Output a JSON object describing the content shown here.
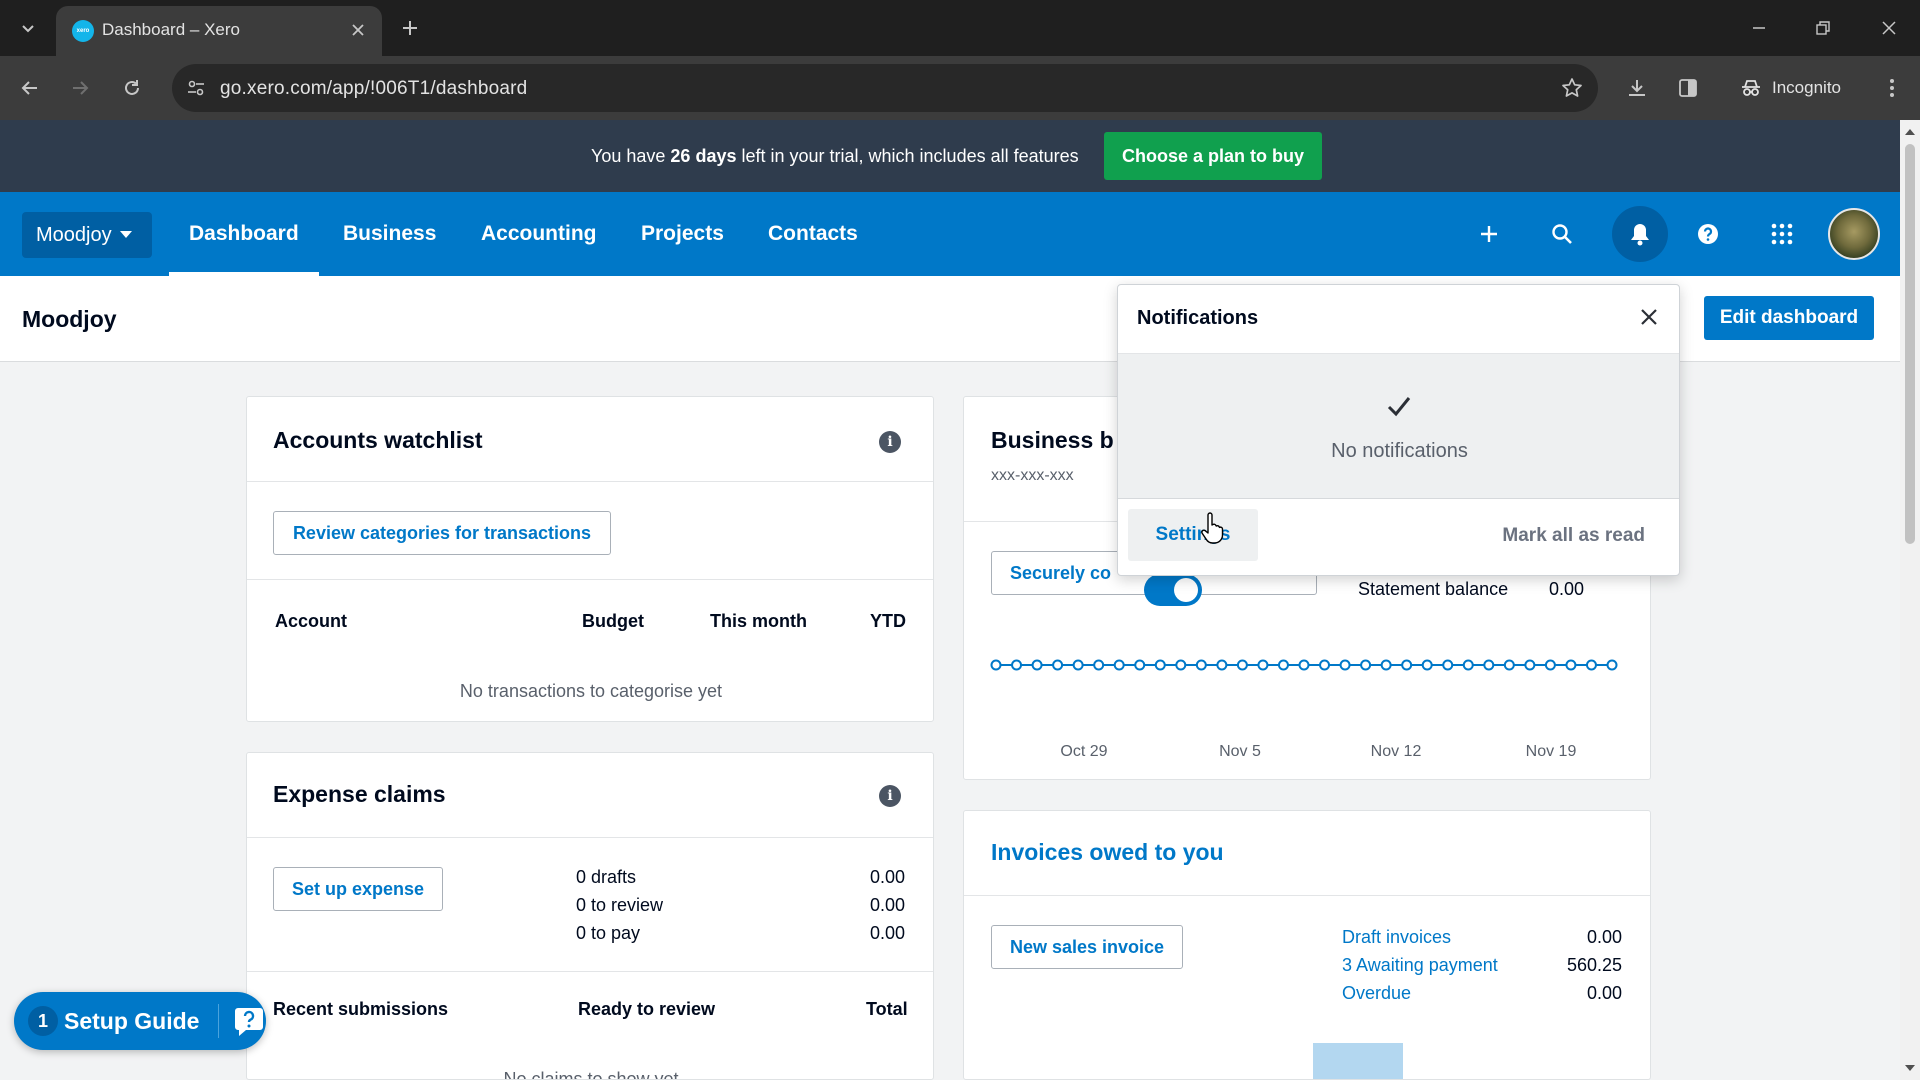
{
  "browser": {
    "tab_title": "Dashboard – Xero",
    "favicon_text": "xero",
    "url": "go.xero.com/app/!006T1/dashboard",
    "incognito_label": "Incognito"
  },
  "trial": {
    "prefix": "You have ",
    "days": "26 days",
    "suffix": " left in your trial, which includes all features",
    "button": "Choose a plan to buy"
  },
  "nav": {
    "org": "Moodjoy",
    "items": [
      {
        "label": "Dashboard",
        "active": true
      },
      {
        "label": "Business"
      },
      {
        "label": "Accounting"
      },
      {
        "label": "Projects"
      },
      {
        "label": "Contacts"
      }
    ]
  },
  "page": {
    "title": "Moodjoy",
    "edit_button": "Edit dashboard"
  },
  "watchlist": {
    "title": "Accounts watchlist",
    "button": "Review categories for transactions",
    "columns": [
      "Account",
      "Budget",
      "This month",
      "YTD"
    ],
    "empty": "No transactions to categorise yet"
  },
  "expenses": {
    "title": "Expense claims",
    "button": "Set up expense",
    "rows": [
      {
        "label": "0 drafts",
        "value": "0.00"
      },
      {
        "label": "0 to review",
        "value": "0.00"
      },
      {
        "label": "0 to pay",
        "value": "0.00"
      }
    ],
    "columns": [
      "Recent submissions",
      "Ready to review",
      "Total"
    ],
    "empty": "No claims to show yet"
  },
  "bank": {
    "title": "Business b",
    "account_number": "xxx-xxx-xxx",
    "connect_button": "Securely co",
    "statement_label": "Statement balance",
    "statement_value": "0.00",
    "x_labels": [
      "Oct 29",
      "Nov 5",
      "Nov 12",
      "Nov 19"
    ],
    "toggle_on": true
  },
  "invoices": {
    "title": "Invoices owed to you",
    "button": "New sales invoice",
    "rows": [
      {
        "label": "Draft invoices",
        "value": "0.00"
      },
      {
        "label": "3 Awaiting payment",
        "value": "560.25"
      },
      {
        "label": "Overdue",
        "value": "0.00"
      }
    ]
  },
  "notifications": {
    "title": "Notifications",
    "empty": "No notifications",
    "settings": "Settings",
    "mark_all": "Mark all as read"
  },
  "setup_guide": {
    "count": "1",
    "label": "Setup Guide"
  },
  "colors": {
    "xero_blue": "#0078c8",
    "banner": "#2f3c4d",
    "cta_green": "#10a04e"
  }
}
